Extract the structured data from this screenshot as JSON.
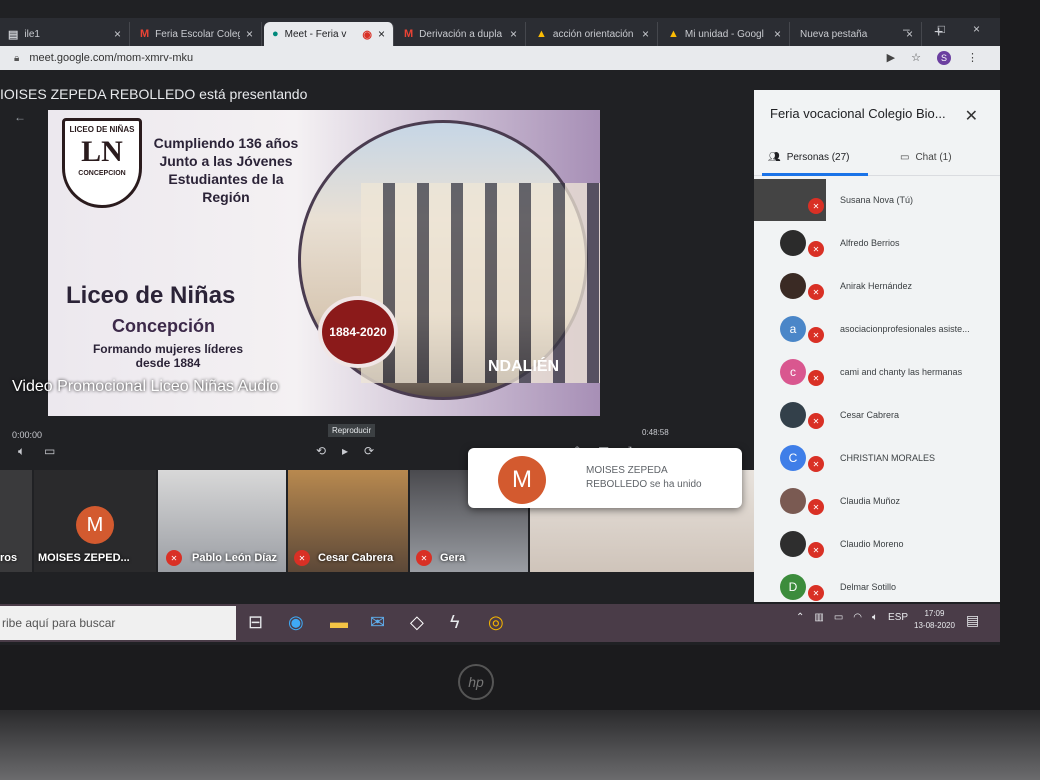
{
  "browser": {
    "tabs": [
      {
        "icon": "file-icon",
        "label": "ile1",
        "active": false
      },
      {
        "icon": "gmail-icon",
        "label": "Feria Escolar Coleg",
        "active": false
      },
      {
        "icon": "meet-icon",
        "label": "Meet - Feria v",
        "active": true
      },
      {
        "icon": "gmail-icon",
        "label": "Derivación a dupla",
        "active": false
      },
      {
        "icon": "drive-icon",
        "label": "acción orientación",
        "active": false
      },
      {
        "icon": "drive-icon",
        "label": "Mi unidad - Googl",
        "active": false
      },
      {
        "icon": "blank-icon",
        "label": "Nueva pestaña",
        "active": false
      }
    ],
    "new_tab": "+",
    "url": "meet.google.com/mom-xmrv-mku"
  },
  "meet": {
    "presenting": "IOISES ZEPEDA REBOLLEDO está presentando",
    "slide": {
      "crest_top": "LICEO DE NIÑAS",
      "crest_letters": "LN",
      "crest_bottom": "CONCEPCION",
      "headline": "Cumpliendo 136 años Junto a las Jóvenes Estudiantes de la Región",
      "school": "Liceo de Niñas",
      "city": "Concepción",
      "motto": "Formando mujeres líderes desde 1884",
      "years": "1884-2020",
      "brand": "NDALIÉN"
    },
    "caption": "Video Promocional Liceo Niñas Audio",
    "player": {
      "time_left": "0:00:00",
      "time_right": "0:48:58",
      "tooltip": "Reproducir"
    },
    "participants": [
      {
        "name": "ros",
        "initial": ""
      },
      {
        "name": "MOISES ZEPED...",
        "initial": "M"
      },
      {
        "name": "Pablo León Díaz",
        "initial": ""
      },
      {
        "name": "Cesar Cabrera",
        "initial": ""
      },
      {
        "name": "Gera",
        "initial": ""
      }
    ],
    "toast": {
      "initial": "M",
      "message": "MOISES ZEPEDA REBOLLEDO se ha unido"
    }
  },
  "panel": {
    "title": "Feria vocacional Colegio Bio...",
    "tab_people": "Personas (27)",
    "tab_chat": "Chat (1)",
    "people": [
      {
        "name": "Susana Nova (Tú)",
        "initial": "",
        "color": "#444444"
      },
      {
        "name": "Alfredo Berrios",
        "initial": "",
        "color": "#2b2b2b"
      },
      {
        "name": "Anirak Hernández",
        "initial": "",
        "color": "#3a2a24"
      },
      {
        "name": "asociacionprofesionales asiste...",
        "initial": "a",
        "color": "#4a86c8"
      },
      {
        "name": "cami and chanty las hermanas",
        "initial": "c",
        "color": "#d9578f"
      },
      {
        "name": "Cesar Cabrera",
        "initial": "",
        "color": "#33404a"
      },
      {
        "name": "CHRISTIAN MORALES",
        "initial": "C",
        "color": "#3f7ee8"
      },
      {
        "name": "Claudia Muñoz",
        "initial": "",
        "color": "#7a5a52"
      },
      {
        "name": "Claudio Moreno",
        "initial": "",
        "color": "#2e2e2e"
      },
      {
        "name": "Delmar Sotillo",
        "initial": "D",
        "color": "#3c8c3c"
      }
    ]
  },
  "taskbar": {
    "search_placeholder": "ribe aquí para buscar",
    "language": "ESP",
    "time": "17:09",
    "date": "13-08-2020"
  },
  "laptop": {
    "brand": "hp"
  }
}
